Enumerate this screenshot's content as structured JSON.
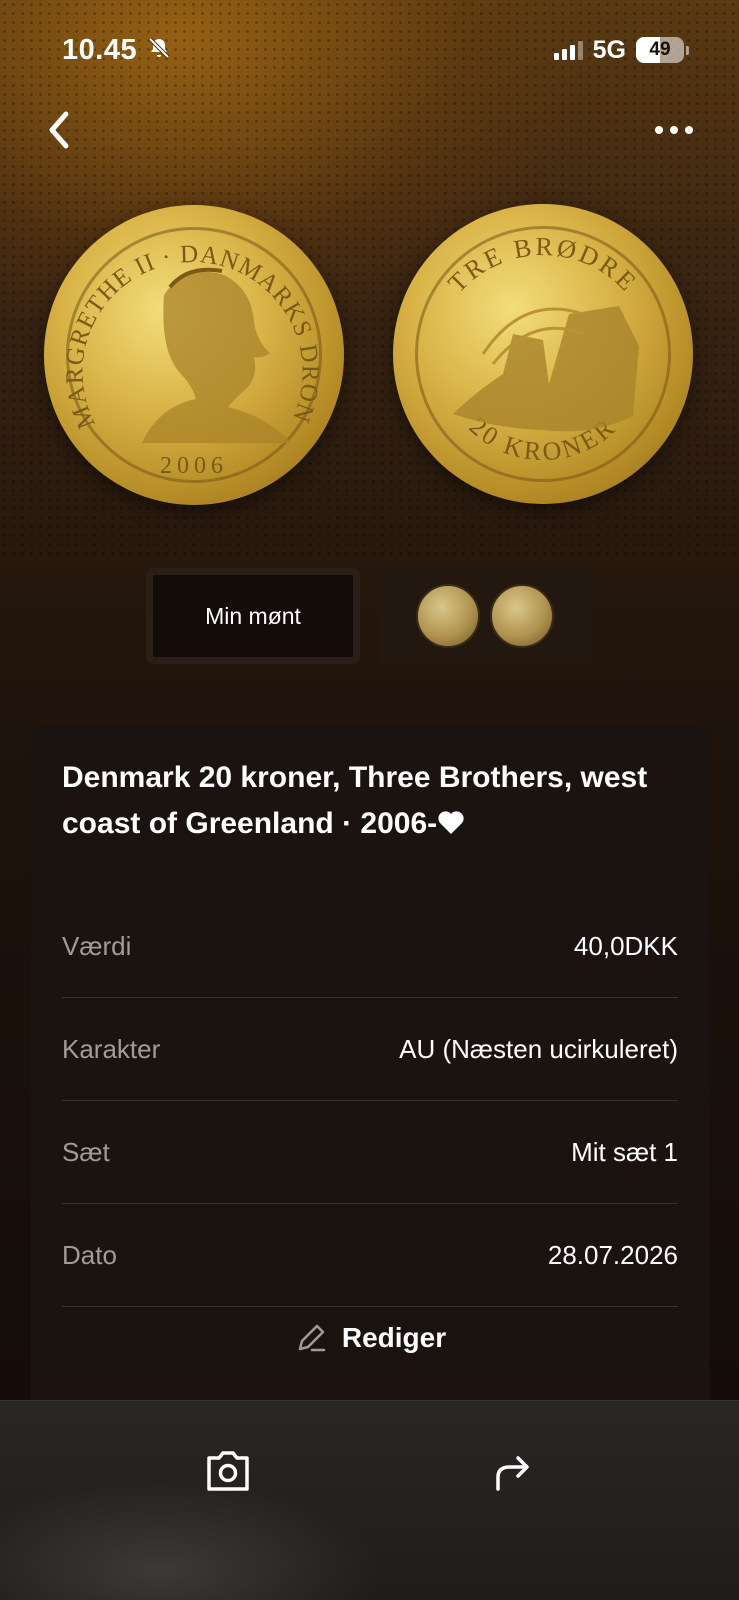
{
  "status_bar": {
    "time": "10.45",
    "network": "5G",
    "battery_level": "49",
    "battery_fraction": 0.49,
    "signal_bars_active": 3,
    "silent_icon": "bell-slash-icon"
  },
  "nav": {
    "back_icon": "chevron-left-icon",
    "more_icon": "ellipsis-icon"
  },
  "selector": {
    "own_coin_label": "Min mønt"
  },
  "coin": {
    "title": "Denmark 20 kroner, Three Brothers, west coast of Greenland · 2006-",
    "favorite_icon": "heart-icon",
    "details": [
      {
        "label": "Værdi",
        "value": "40,0DKK"
      },
      {
        "label": "Karakter",
        "value": "AU (Næsten ucirkuleret)"
      },
      {
        "label": "Sæt",
        "value": "Mit sæt 1"
      },
      {
        "label": "Dato",
        "value": "28.07.2026"
      }
    ],
    "edit_label": "Rediger",
    "edit_icon": "pencil-icon"
  },
  "obverse_legend": {
    "left": "MARGRETHE II",
    "top": "DANMARKS DRONNING",
    "year": "2006"
  },
  "reverse_legend": {
    "top": "TRE BRØDRE",
    "bottom": "20 KRONER"
  },
  "toolbar": {
    "camera_icon": "camera-icon",
    "share_icon": "share-arrow-icon"
  },
  "colors": {
    "gold": "#d9b347",
    "card_bg": "#1b1310",
    "muted_text": "#a39b97"
  }
}
